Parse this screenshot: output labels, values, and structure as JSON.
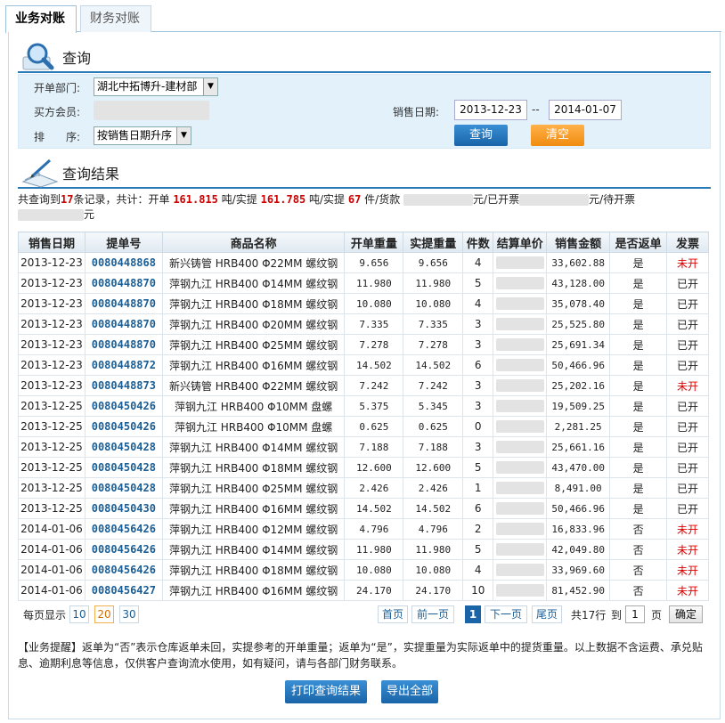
{
  "tabs": [
    "业务对账",
    "财务对账"
  ],
  "query": {
    "title": "查询",
    "dept_label": "开单部门:",
    "dept_value": "湖北中拓博升-建材部",
    "member_label": "买方会员:",
    "sort_label": "排　　序:",
    "sort_value": "按销售日期升序",
    "date_label": "销售日期:",
    "date_from": "2013-12-23",
    "date_sep": "--",
    "date_to": "2014-01-07",
    "search_btn": "查询",
    "clear_btn": "清空"
  },
  "results": {
    "title": "查询结果",
    "summary": {
      "t1": "共查询到",
      "count": "17",
      "t2": "条记录，共计：开单",
      "open_weight": "161.815",
      "t3": "吨/实提",
      "real_weight": "161.785",
      "t4": "吨/实提",
      "pieces": "67",
      "t5": "件/货款",
      "t6": "元/已开票",
      "t7": "元/待开票",
      "t8": "元"
    }
  },
  "table": {
    "headers": [
      "销售日期",
      "提单号",
      "商品名称",
      "开单重量",
      "实提重量",
      "件数",
      "结算单价",
      "销售金额",
      "是否返单",
      "发票"
    ],
    "rows": [
      [
        "2013-12-23",
        "0080448868",
        "新兴铸管 HRB400 Φ22MM 螺纹钢",
        "9.656",
        "9.656",
        "4",
        "",
        "33,602.88",
        "是",
        "未开"
      ],
      [
        "2013-12-23",
        "0080448870",
        "萍钢九江 HRB400 Φ14MM 螺纹钢",
        "11.980",
        "11.980",
        "5",
        "",
        "43,128.00",
        "是",
        "已开"
      ],
      [
        "2013-12-23",
        "0080448870",
        "萍钢九江 HRB400 Φ18MM 螺纹钢",
        "10.080",
        "10.080",
        "4",
        "",
        "35,078.40",
        "是",
        "已开"
      ],
      [
        "2013-12-23",
        "0080448870",
        "萍钢九江 HRB400 Φ20MM 螺纹钢",
        "7.335",
        "7.335",
        "3",
        "",
        "25,525.80",
        "是",
        "已开"
      ],
      [
        "2013-12-23",
        "0080448870",
        "萍钢九江 HRB400 Φ25MM 螺纹钢",
        "7.278",
        "7.278",
        "3",
        "",
        "25,691.34",
        "是",
        "已开"
      ],
      [
        "2013-12-23",
        "0080448872",
        "萍钢九江 HRB400 Φ16MM 螺纹钢",
        "14.502",
        "14.502",
        "6",
        "",
        "50,466.96",
        "是",
        "已开"
      ],
      [
        "2013-12-23",
        "0080448873",
        "新兴铸管 HRB400 Φ22MM 螺纹钢",
        "7.242",
        "7.242",
        "3",
        "",
        "25,202.16",
        "是",
        "未开"
      ],
      [
        "2013-12-25",
        "0080450426",
        "萍钢九江 HRB400 Φ10MM 盘螺",
        "5.375",
        "5.345",
        "3",
        "",
        "19,509.25",
        "是",
        "已开"
      ],
      [
        "2013-12-25",
        "0080450426",
        "萍钢九江 HRB400 Φ10MM 盘螺",
        "0.625",
        "0.625",
        "0",
        "",
        "2,281.25",
        "是",
        "已开"
      ],
      [
        "2013-12-25",
        "0080450428",
        "萍钢九江 HRB400 Φ14MM 螺纹钢",
        "7.188",
        "7.188",
        "3",
        "",
        "25,661.16",
        "是",
        "已开"
      ],
      [
        "2013-12-25",
        "0080450428",
        "萍钢九江 HRB400 Φ18MM 螺纹钢",
        "12.600",
        "12.600",
        "5",
        "",
        "43,470.00",
        "是",
        "已开"
      ],
      [
        "2013-12-25",
        "0080450428",
        "萍钢九江 HRB400 Φ25MM 螺纹钢",
        "2.426",
        "2.426",
        "1",
        "",
        "8,491.00",
        "是",
        "已开"
      ],
      [
        "2013-12-25",
        "0080450430",
        "萍钢九江 HRB400 Φ16MM 螺纹钢",
        "14.502",
        "14.502",
        "6",
        "",
        "50,466.96",
        "是",
        "已开"
      ],
      [
        "2014-01-06",
        "0080456426",
        "萍钢九江 HRB400 Φ12MM 螺纹钢",
        "4.796",
        "4.796",
        "2",
        "",
        "16,833.96",
        "否",
        "未开"
      ],
      [
        "2014-01-06",
        "0080456426",
        "萍钢九江 HRB400 Φ14MM 螺纹钢",
        "11.980",
        "11.980",
        "5",
        "",
        "42,049.80",
        "否",
        "未开"
      ],
      [
        "2014-01-06",
        "0080456426",
        "萍钢九江 HRB400 Φ18MM 螺纹钢",
        "10.080",
        "10.080",
        "4",
        "",
        "33,969.60",
        "否",
        "未开"
      ],
      [
        "2014-01-06",
        "0080456427",
        "萍钢九江 HRB400 Φ16MM 螺纹钢",
        "24.170",
        "24.170",
        "10",
        "",
        "81,452.90",
        "否",
        "未开"
      ]
    ]
  },
  "pager": {
    "per_page_label": "每页显示",
    "sizes": [
      "10",
      "20",
      "30"
    ],
    "first": "首页",
    "prev": "前一页",
    "current": "1",
    "next": "下一页",
    "last": "尾页",
    "total": "共17行",
    "goto_label": "到",
    "goto_value": "1",
    "page_label": "页",
    "confirm": "确定"
  },
  "notice": "【业务提醒】返单为“否”表示仓库返单未回，实提参考的开单重量；返单为“是”，实提重量为实际返单中的提货重量。以上数据不含运费、承兑贴息、逾期利息等信息，仅供客户查询流水使用，如有疑问，请与各部门财务联系。",
  "actions": {
    "print": "打印查询结果",
    "export": "导出全部"
  },
  "colors": {
    "accent": "#1a64a8",
    "highlight": "#cc0000",
    "link": "#1a5e95",
    "panel": "#e3f1fb",
    "orange": "#f08c10"
  }
}
